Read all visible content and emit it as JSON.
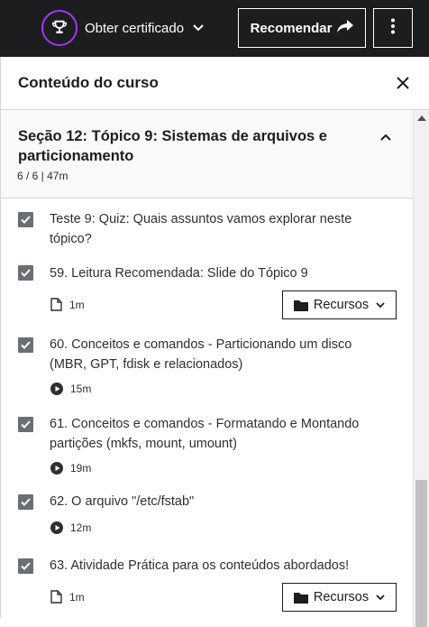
{
  "topbar": {
    "certificate_label": "Obter certificado",
    "recommend_label": "Recomendar"
  },
  "panel": {
    "title": "Conteúdo do curso"
  },
  "section": {
    "title": "Seção 12: Tópico 9: Sistemas de arquivos e particionamento",
    "meta": "6 / 6 | 47m"
  },
  "items": [
    {
      "title": "Teste 9: Quiz: Quais assuntos vamos explorar neste tópico?",
      "checked": true
    },
    {
      "title": "59. Leitura Recomendada: Slide do Tópico 9",
      "duration": "1m",
      "type_icon": "file-icon",
      "resources_label": "Recursos",
      "checked": true
    },
    {
      "title": "60. Conceitos e comandos - Particionando um disco (MBR, GPT, fdisk e relacionados)",
      "duration": "15m",
      "type_icon": "play-icon",
      "checked": true
    },
    {
      "title": "61. Conceitos e comandos - Formatando e Montando partições (mkfs, mount, umount)",
      "duration": "19m",
      "type_icon": "play-icon",
      "checked": true
    },
    {
      "title": "62. O arquivo \"/etc/fstab\"",
      "duration": "12m",
      "type_icon": "play-icon",
      "checked": true
    },
    {
      "title": "63. Atividade Prática para os conteúdos abordados!",
      "duration": "1m",
      "type_icon": "file-icon",
      "resources_label": "Recursos",
      "checked": true
    }
  ],
  "colors": {
    "topbar_bg": "#1c1d1f",
    "accent_purple": "#a435f0",
    "checkbox": "#6a6f73",
    "section_bg": "#f7f9fa"
  }
}
